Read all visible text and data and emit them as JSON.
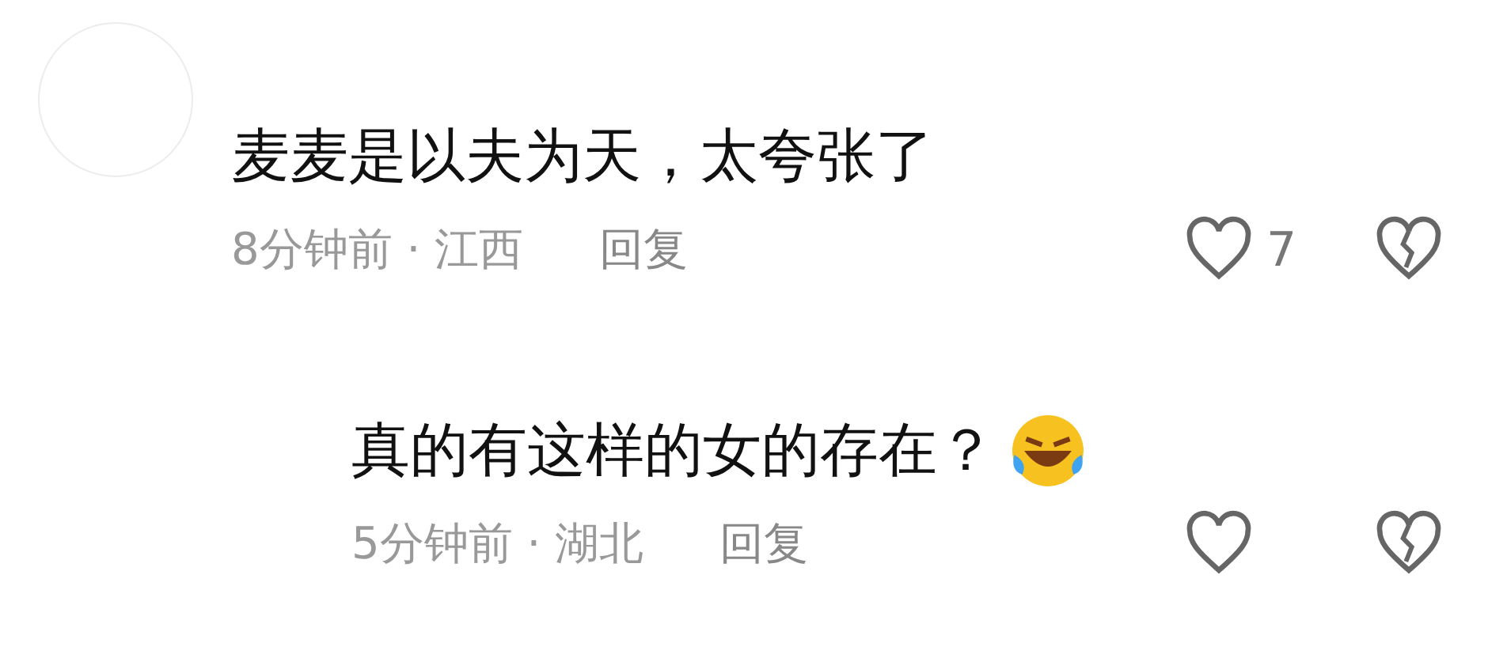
{
  "comments": [
    {
      "text": "麦麦是以夫为天，太夸张了",
      "emoji": false,
      "meta": "8分钟前 · 江西",
      "reply": "回复",
      "likes": "7",
      "children": [
        {
          "text": "真的有这样的女的存在？",
          "emoji": true,
          "meta": "5分钟前 · 湖北",
          "reply": "回复"
        }
      ]
    }
  ]
}
